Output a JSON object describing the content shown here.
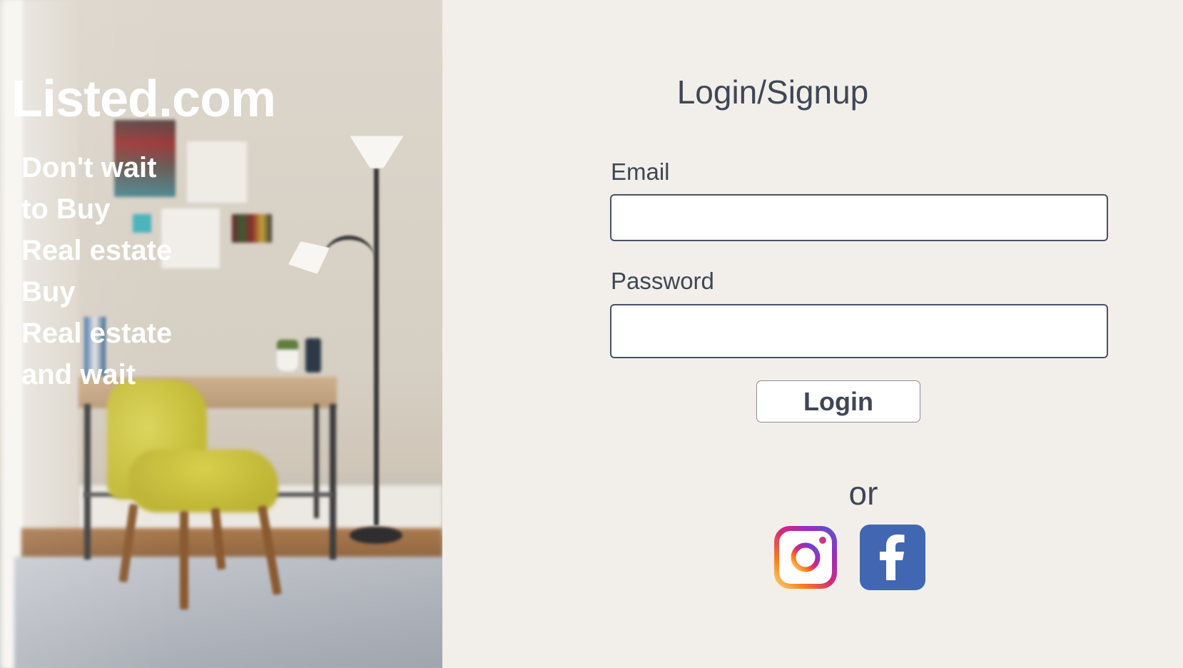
{
  "hero": {
    "brand": "Listed.com",
    "tagline_lines": [
      "Don't wait",
      "to Buy",
      "Real estate",
      "Buy",
      "Real estate",
      "and wait"
    ]
  },
  "form": {
    "title": "Login/Signup",
    "email_label": "Email",
    "email_value": "",
    "password_label": "Password",
    "password_value": "",
    "login_label": "Login",
    "or_text": "or"
  },
  "social": {
    "icons": [
      "instagram-icon",
      "facebook-icon"
    ]
  },
  "colors": {
    "text": "#3f4656",
    "background": "#f2efea",
    "input_border": "#4a5266",
    "facebook_blue": "#4267b2",
    "instagram_gradient": [
      "#feda75",
      "#fa7e1e",
      "#d62976",
      "#962fbf",
      "#4f5bd5"
    ]
  }
}
